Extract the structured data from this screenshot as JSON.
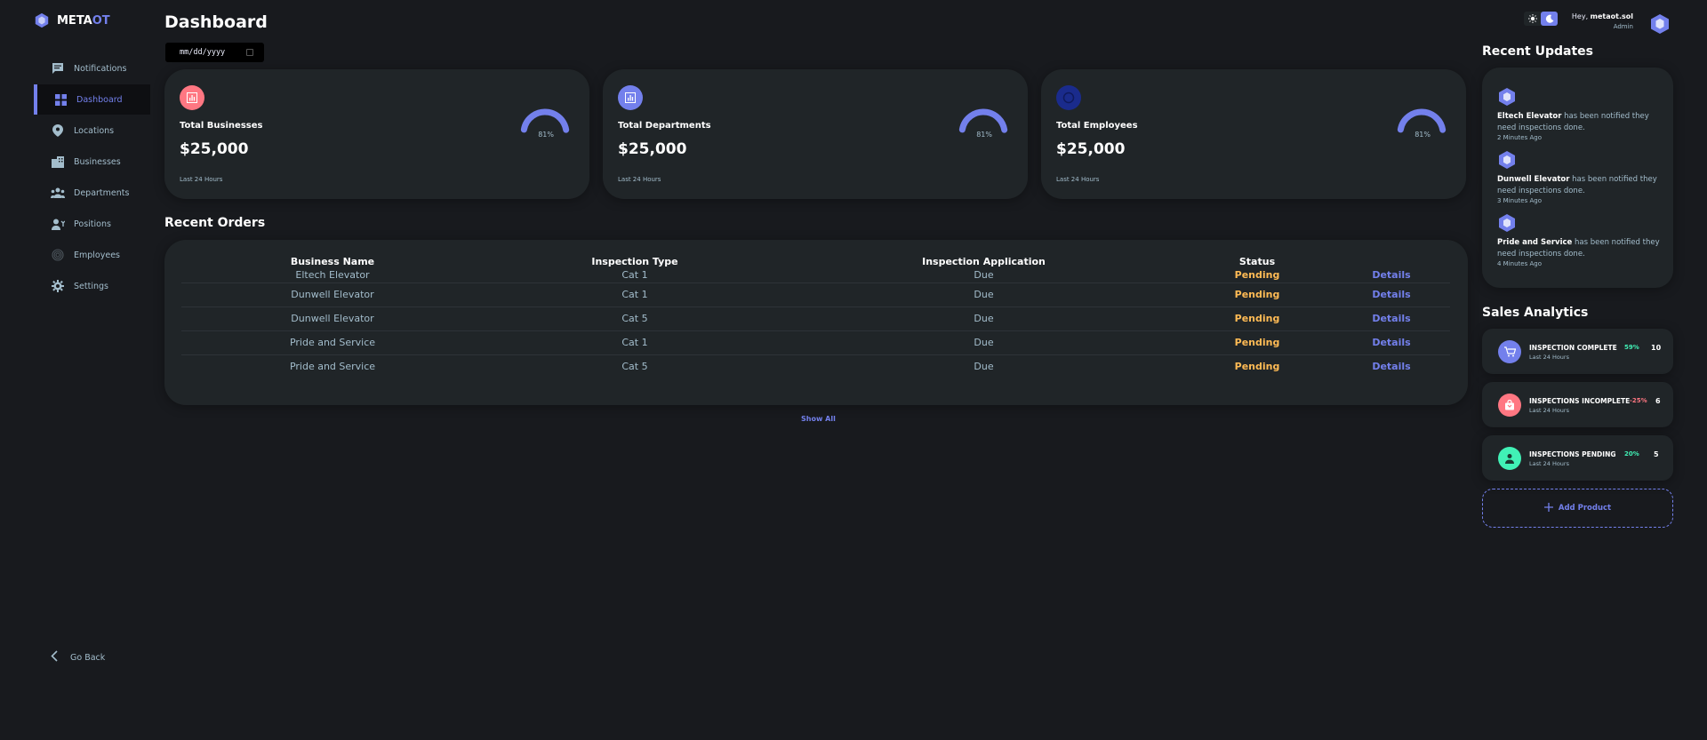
{
  "brand": {
    "name_main": "META",
    "name_accent": "OT"
  },
  "sidebar": {
    "items": [
      {
        "label": "Notifications",
        "icon": "chat-icon"
      },
      {
        "label": "Dashboard",
        "icon": "grid-icon",
        "active": true
      },
      {
        "label": "Locations",
        "icon": "location-pin-icon"
      },
      {
        "label": "Businesses",
        "icon": "buildings-icon"
      },
      {
        "label": "Departments",
        "icon": "groups-icon"
      },
      {
        "label": "Positions",
        "icon": "person-position-icon"
      },
      {
        "label": "Employees",
        "icon": "fingerprint-icon"
      },
      {
        "label": "Settings",
        "icon": "gear-icon"
      }
    ],
    "go_back": "Go Back"
  },
  "header": {
    "title": "Dashboard",
    "date_placeholder": "mm/dd/yyyy"
  },
  "profile": {
    "greeting": "Hey,",
    "username": "metaot.sol",
    "role": "Admin"
  },
  "cards": [
    {
      "label": "Total Businesses",
      "value": "$25,000",
      "percent": "81%",
      "fraction": 0.81,
      "foot": "Last 24 Hours",
      "icon": "bar-chart-icon",
      "icon_color": "#ff7782"
    },
    {
      "label": "Total Departments",
      "value": "$25,000",
      "percent": "81%",
      "fraction": 0.81,
      "foot": "Last 24 Hours",
      "icon": "bar-chart-icon",
      "icon_color": "#7380ec"
    },
    {
      "label": "Total Employees",
      "value": "$25,000",
      "percent": "81%",
      "fraction": 0.81,
      "foot": "Last 24 Hours",
      "icon": "circle-icon",
      "icon_color": "#1a2b8c"
    }
  ],
  "orders": {
    "title": "Recent Orders",
    "columns": [
      "Business Name",
      "Inspection Type",
      "Inspection Application",
      "Status",
      ""
    ],
    "rows": [
      {
        "business": "Eltech Elevator",
        "type": "Cat 1",
        "application": "Due",
        "status": "Pending",
        "action": "Details"
      },
      {
        "business": "Dunwell Elevator",
        "type": "Cat 1",
        "application": "Due",
        "status": "Pending",
        "action": "Details"
      },
      {
        "business": "Dunwell Elevator",
        "type": "Cat 5",
        "application": "Due",
        "status": "Pending",
        "action": "Details"
      },
      {
        "business": "Pride and Service",
        "type": "Cat 1",
        "application": "Due",
        "status": "Pending",
        "action": "Details"
      },
      {
        "business": "Pride and Service",
        "type": "Cat 5",
        "application": "Due",
        "status": "Pending",
        "action": "Details"
      }
    ],
    "show_all": "Show All"
  },
  "updates": {
    "title": "Recent Updates",
    "items": [
      {
        "name": "Eltech Elevator",
        "message": " has been notified they need inspections done.",
        "time": "2 Minutes Ago"
      },
      {
        "name": "Dunwell Elevator",
        "message": " has been notified they need inspections done.",
        "time": "3 Minutes Ago"
      },
      {
        "name": "Pride and Service",
        "message": " has been notified they need inspections done.",
        "time": "4 Minutes Ago"
      }
    ]
  },
  "sales": {
    "title": "Sales Analytics",
    "items": [
      {
        "title": "INSPECTION COMPLETE",
        "sub": "Last 24 Hours",
        "pct": "59%",
        "count": "10",
        "icon": "cart-icon",
        "icon_color": "#7380ec",
        "pct_color": "#41f1b6"
      },
      {
        "title": "INSPECTIONS INCOMPLETE",
        "sub": "Last 24 Hours",
        "pct": "-25%",
        "count": "6",
        "icon": "bag-icon",
        "icon_color": "#ff7782",
        "pct_color": "#ff7782"
      },
      {
        "title": "INSPECTIONS PENDING",
        "sub": "Last 24 Hours",
        "pct": "20%",
        "count": "5",
        "icon": "person-icon",
        "icon_color": "#41f1b6",
        "pct_color": "#41f1b6"
      }
    ],
    "add_product": "Add Product"
  }
}
